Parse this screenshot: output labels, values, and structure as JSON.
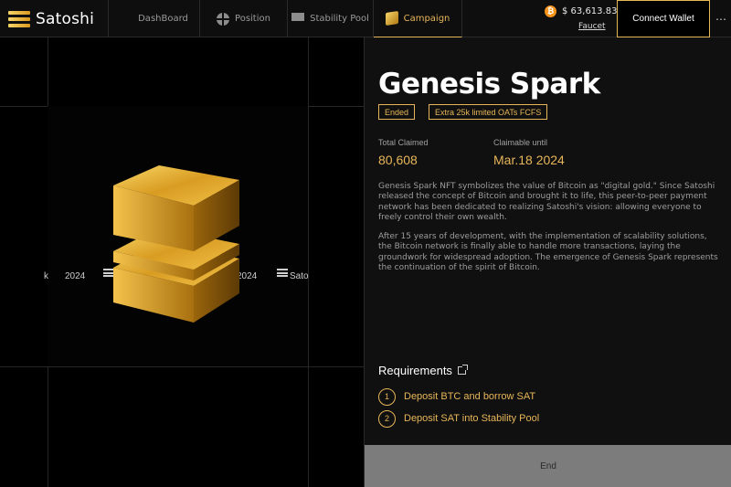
{
  "header": {
    "brand": "Satoshi",
    "nav": [
      {
        "label": "DashBoard",
        "icon": "dashboard-icon"
      },
      {
        "label": "Position",
        "icon": "position-icon"
      },
      {
        "label": "Stability Pool",
        "icon": "stability-pool-icon"
      },
      {
        "label": "Campaign",
        "icon": "campaign-icon",
        "active": true
      }
    ],
    "btc_price": "$ 63,613.83",
    "btc_symbol": "₿",
    "faucet_label": "Faucet",
    "connect_label": "Connect Wallet",
    "more_label": "⋯"
  },
  "artwork": {
    "ticker_left": "2024",
    "ticker_right": "2024",
    "ticker_right_brand": "Sato",
    "ticker_edge": "k"
  },
  "campaign": {
    "title": "Genesis Spark",
    "badges": [
      "Ended",
      "Extra 25k limited OATs FCFS"
    ],
    "total_claimed_label": "Total Claimed",
    "total_claimed_value": "80,608",
    "claimable_label": "Claimable until",
    "claimable_value": "Mar.18 2024",
    "description_1": "Genesis Spark NFT symbolizes the value of Bitcoin as \"digital gold.\" Since Satoshi released the concept of Bitcoin and brought it to life, this peer-to-peer payment network has been dedicated to realizing Satoshi's vision: allowing everyone to freely control their own wealth.",
    "description_2": "After 15 years of development, with the implementation of scalability solutions, the Bitcoin network is finally able to handle more transactions, laying the groundwork for widespread adoption. The emergence of Genesis Spark represents the continuation of the spirit of Bitcoin.",
    "requirements_title": "Requirements",
    "requirements": [
      {
        "num": "1",
        "text": "Deposit BTC and borrow SAT"
      },
      {
        "num": "2",
        "text": "Deposit SAT into Stability Pool"
      }
    ],
    "end_label": "End"
  },
  "colors": {
    "accent": "#e7b659",
    "bitcoin": "#f7931a",
    "background": "#0c0c0c",
    "button_disabled": "#7c7c7c"
  }
}
